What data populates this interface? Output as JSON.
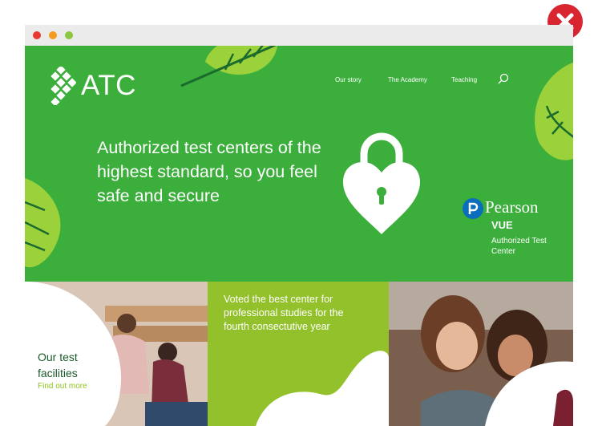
{
  "window": {
    "traffic_lights": [
      "#e8382f",
      "#f39c21",
      "#8dc63f"
    ]
  },
  "close_button": {
    "icon": "close-x-icon",
    "color": "#d8252f"
  },
  "header": {
    "logo_text": "ATC",
    "nav": [
      "Our story",
      "The Academy",
      "Teaching"
    ],
    "search_icon": "search-icon"
  },
  "hero": {
    "headline": "Authorized test centers of the highest standard, so you feel safe and secure",
    "background": "#3bae3b",
    "badge": {
      "brand": "Pearson",
      "product": "VUE",
      "subtitle": "Authorized Test Center"
    }
  },
  "tiles": [
    {
      "title": "Our test facilities",
      "link": "Find out more"
    },
    {
      "text": "Voted the  best center for professional studies  for the fourth consectutive year"
    },
    {}
  ]
}
